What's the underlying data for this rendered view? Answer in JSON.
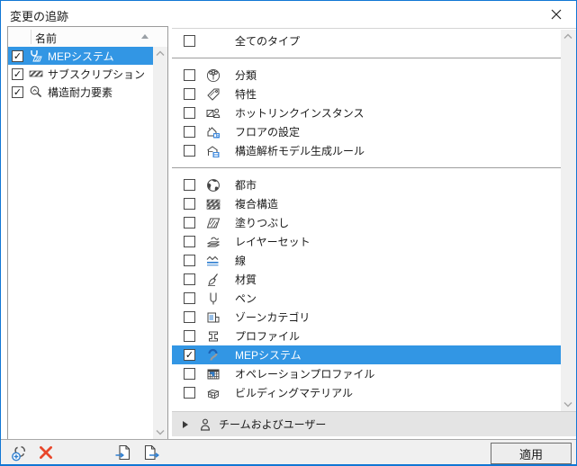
{
  "window": {
    "title": "変更の追跡",
    "icon": "close-icon"
  },
  "colors": {
    "selection_blue": "#3296e4",
    "window_border_blue": "#1177d4",
    "icon_accent_blue": "#2f7fd0",
    "delete_red": "#e8472b"
  },
  "left_panel": {
    "column_header": "名前",
    "sort_icon": "sort-ascending-icon",
    "scrollbar": {
      "up_icon": "scroll-up-icon",
      "down_icon": "scroll-down-icon"
    },
    "rows": [
      {
        "label": "MEPシステム",
        "check": "✓",
        "icon": "mep-system-icon",
        "selected": true
      },
      {
        "label": "サブスクリプション",
        "check": "✓",
        "icon": "subscription-icon",
        "selected": false
      },
      {
        "label": "構造耐力要素",
        "check": "✓",
        "icon": "structural-element-icon",
        "selected": false
      }
    ]
  },
  "right_panel": {
    "scrollbar": {
      "up_icon": "scroll-up-icon",
      "down_icon": "scroll-down-icon"
    },
    "groups": [
      {
        "rows": [
          {
            "label": "全てのタイプ",
            "check": ""
          }
        ]
      },
      {
        "rows": [
          {
            "label": "分類",
            "check": "",
            "icon": "classification-icon"
          },
          {
            "label": "特性",
            "check": "",
            "icon": "properties-icon"
          },
          {
            "label": "ホットリンクインスタンス",
            "check": "",
            "icon": "hotlink-instance-icon"
          },
          {
            "label": "フロアの設定",
            "check": "",
            "icon": "story-settings-icon"
          },
          {
            "label": "構造解析モデル生成ルール",
            "check": "",
            "icon": "structural-analysis-rules-icon"
          }
        ]
      },
      {
        "rows": [
          {
            "label": "都市",
            "check": "",
            "icon": "city-icon"
          },
          {
            "label": "複合構造",
            "check": "",
            "icon": "composite-structure-icon"
          },
          {
            "label": "塗りつぶし",
            "check": "",
            "icon": "fill-icon"
          },
          {
            "label": "レイヤーセット",
            "check": "",
            "icon": "layer-set-icon"
          },
          {
            "label": "線",
            "check": "",
            "icon": "line-type-icon"
          },
          {
            "label": "材質",
            "check": "",
            "icon": "surface-icon"
          },
          {
            "label": "ペン",
            "check": "",
            "icon": "pen-icon"
          },
          {
            "label": "ゾーンカテゴリ",
            "check": "",
            "icon": "zone-category-icon"
          },
          {
            "label": "プロファイル",
            "check": "",
            "icon": "profile-icon"
          },
          {
            "label": "MEPシステム",
            "check": "✓",
            "icon": "mep-system-icon",
            "selected": true
          },
          {
            "label": "オペレーションプロファイル",
            "check": "",
            "icon": "operation-profile-icon"
          },
          {
            "label": "ビルディングマテリアル",
            "check": "",
            "icon": "building-material-icon"
          }
        ]
      }
    ],
    "team_section": {
      "label": "チームおよびユーザー",
      "expander_icon": "expand-right-icon",
      "icon": "user-icon"
    }
  },
  "footer": {
    "buttons": [
      {
        "name": "add-change-button",
        "icon": "add-change-icon"
      },
      {
        "name": "delete-change-button",
        "icon": "delete-x-icon"
      },
      {
        "name": "import-button",
        "icon": "import-file-icon"
      },
      {
        "name": "export-button",
        "icon": "export-file-icon"
      }
    ],
    "apply_label": "適用"
  }
}
